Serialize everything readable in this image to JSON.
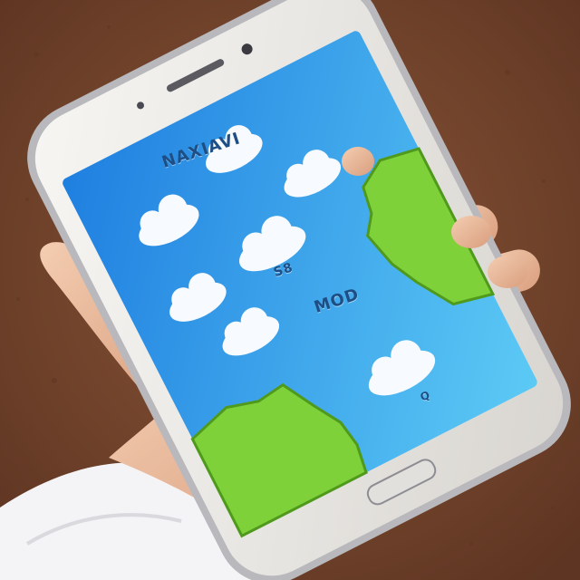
{
  "photo": {
    "subject": "smartphone-in-hand",
    "colors": {
      "soil": "#7a4a30",
      "soil_dark": "#5e3522",
      "skin": "#f0c3a6",
      "skin_shadow": "#d79f80",
      "sleeve": "#f4f4f6",
      "phone_body": "#eceae6",
      "phone_rim": "#b9b9bd",
      "screen_sky_top": "#1f7fe0",
      "screen_sky_bottom": "#4fc1f2",
      "grass": "#7fd13a",
      "grass_dark": "#4f9a1c",
      "cloud": "#f7fbff"
    }
  },
  "screen": {
    "title_text": "NAXIAVI",
    "middle_text": "S8",
    "label_text": "MOD",
    "small_text": "Q"
  }
}
